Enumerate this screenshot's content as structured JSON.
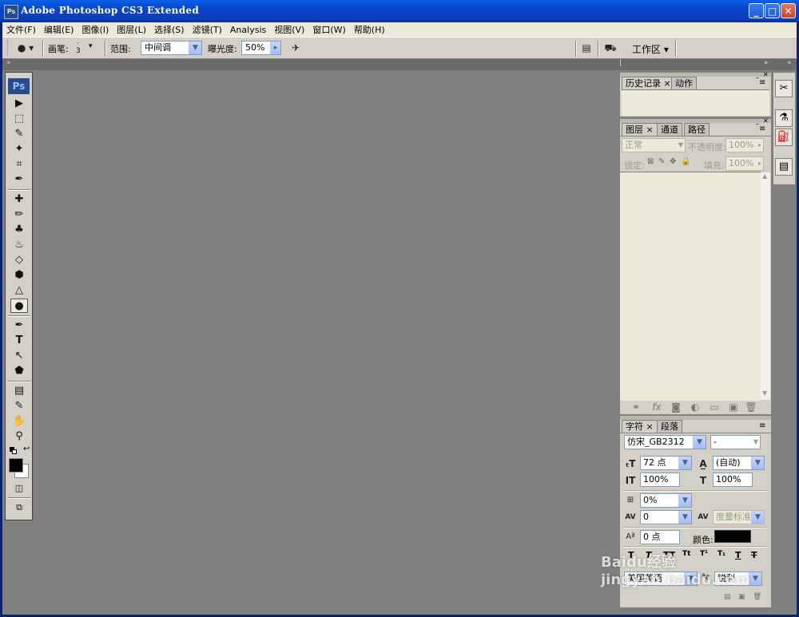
{
  "window": {
    "title": "Adobe Photoshop CS3 Extended",
    "app_icon": "Ps",
    "minimize": "_",
    "maximize": "□",
    "close": "✕"
  },
  "menu": [
    "文件(F)",
    "编辑(E)",
    "图像(I)",
    "图层(L)",
    "选择(S)",
    "滤镜(T)",
    "Analysis",
    "视图(V)",
    "窗口(W)",
    "帮助(H)"
  ],
  "options": {
    "brush_label": "画笔:",
    "brush_size": "3",
    "range_label": "范围:",
    "range_value": "中间调",
    "exposure_label": "曝光度:",
    "exposure_value": "50%",
    "workspace_label": "工作区 ▾"
  },
  "tools": {
    "logo": "Ps",
    "items": [
      "▶",
      "⬚",
      "✎",
      "✦",
      "⌗",
      "✒",
      "✚",
      "✏",
      "♣",
      "♨",
      "◇",
      "⬢",
      "△",
      "●",
      "✒",
      "T",
      "↖",
      "⬟",
      "▤",
      "✎",
      "✋",
      "⚲"
    ]
  },
  "history_panel": {
    "tabs": [
      "历史记录 ×",
      "动作"
    ]
  },
  "layers_panel": {
    "tabs": [
      "图层 ×",
      "通道",
      "路径"
    ],
    "blend_mode": "正常",
    "opacity_label": "不透明度:",
    "opacity_value": "100%",
    "lock_label": "锁定:",
    "fill_label": "填充:",
    "fill_value": "100%",
    "footer_icons": [
      "⚭",
      "fx",
      "◙",
      "◐",
      "▭",
      "▣",
      "🗑"
    ]
  },
  "character_panel": {
    "tabs": [
      "字符 ×",
      "段落"
    ],
    "font_family": "仿宋_GB2312",
    "font_style": "-",
    "font_size": "72 点",
    "leading": "(自动)",
    "vertical_scale": "100%",
    "horizontal_scale": "100%",
    "tracking_ratio": "0%",
    "kerning": "0",
    "tracking": "度量标准",
    "baseline_shift": "0 点",
    "color_label": "颜色:",
    "color_value": "#000000",
    "language": "美国英语",
    "aa_label": "ªa",
    "antialias": "锐利"
  },
  "watermark": "Baidu经验 jingyan.baidu.com"
}
